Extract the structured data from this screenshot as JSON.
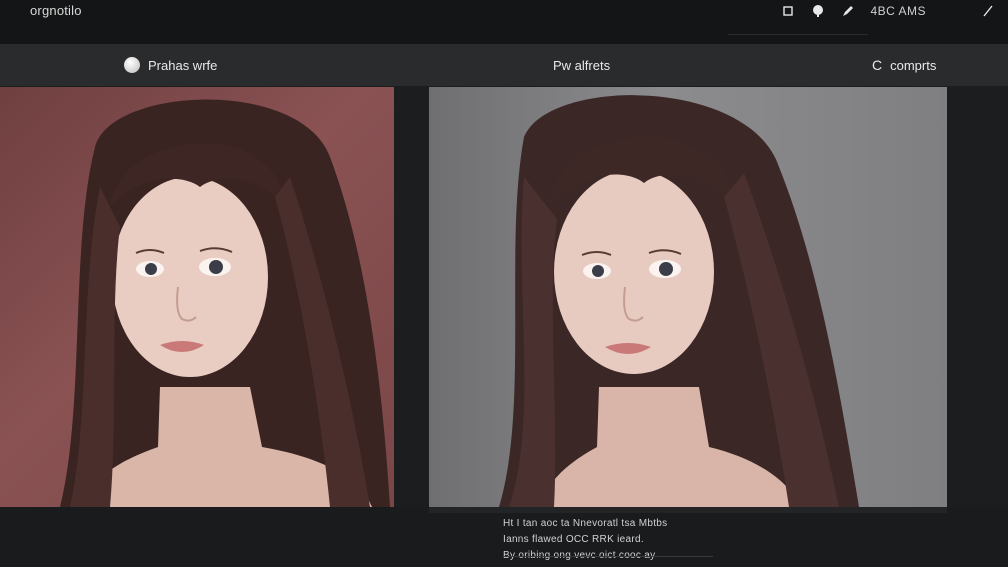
{
  "app": {
    "title": "orgnotilo"
  },
  "topbar": {
    "icons": [
      "square-icon",
      "brain-icon",
      "edit-icon",
      "slash-icon"
    ],
    "label": "4BC AMS"
  },
  "tabs": {
    "left": "Prahas wrfe",
    "center": "Pw alfrets",
    "right": "comprts",
    "right_icon": "C"
  },
  "caption": {
    "line1": "Ht  I tan aoc ta Nnevoratl  tsa  Mbtbs",
    "line2": "Ianns flawed  OCC  RRK  ieard.",
    "line3": "By  oribing ong vevc oict cooc ay"
  }
}
